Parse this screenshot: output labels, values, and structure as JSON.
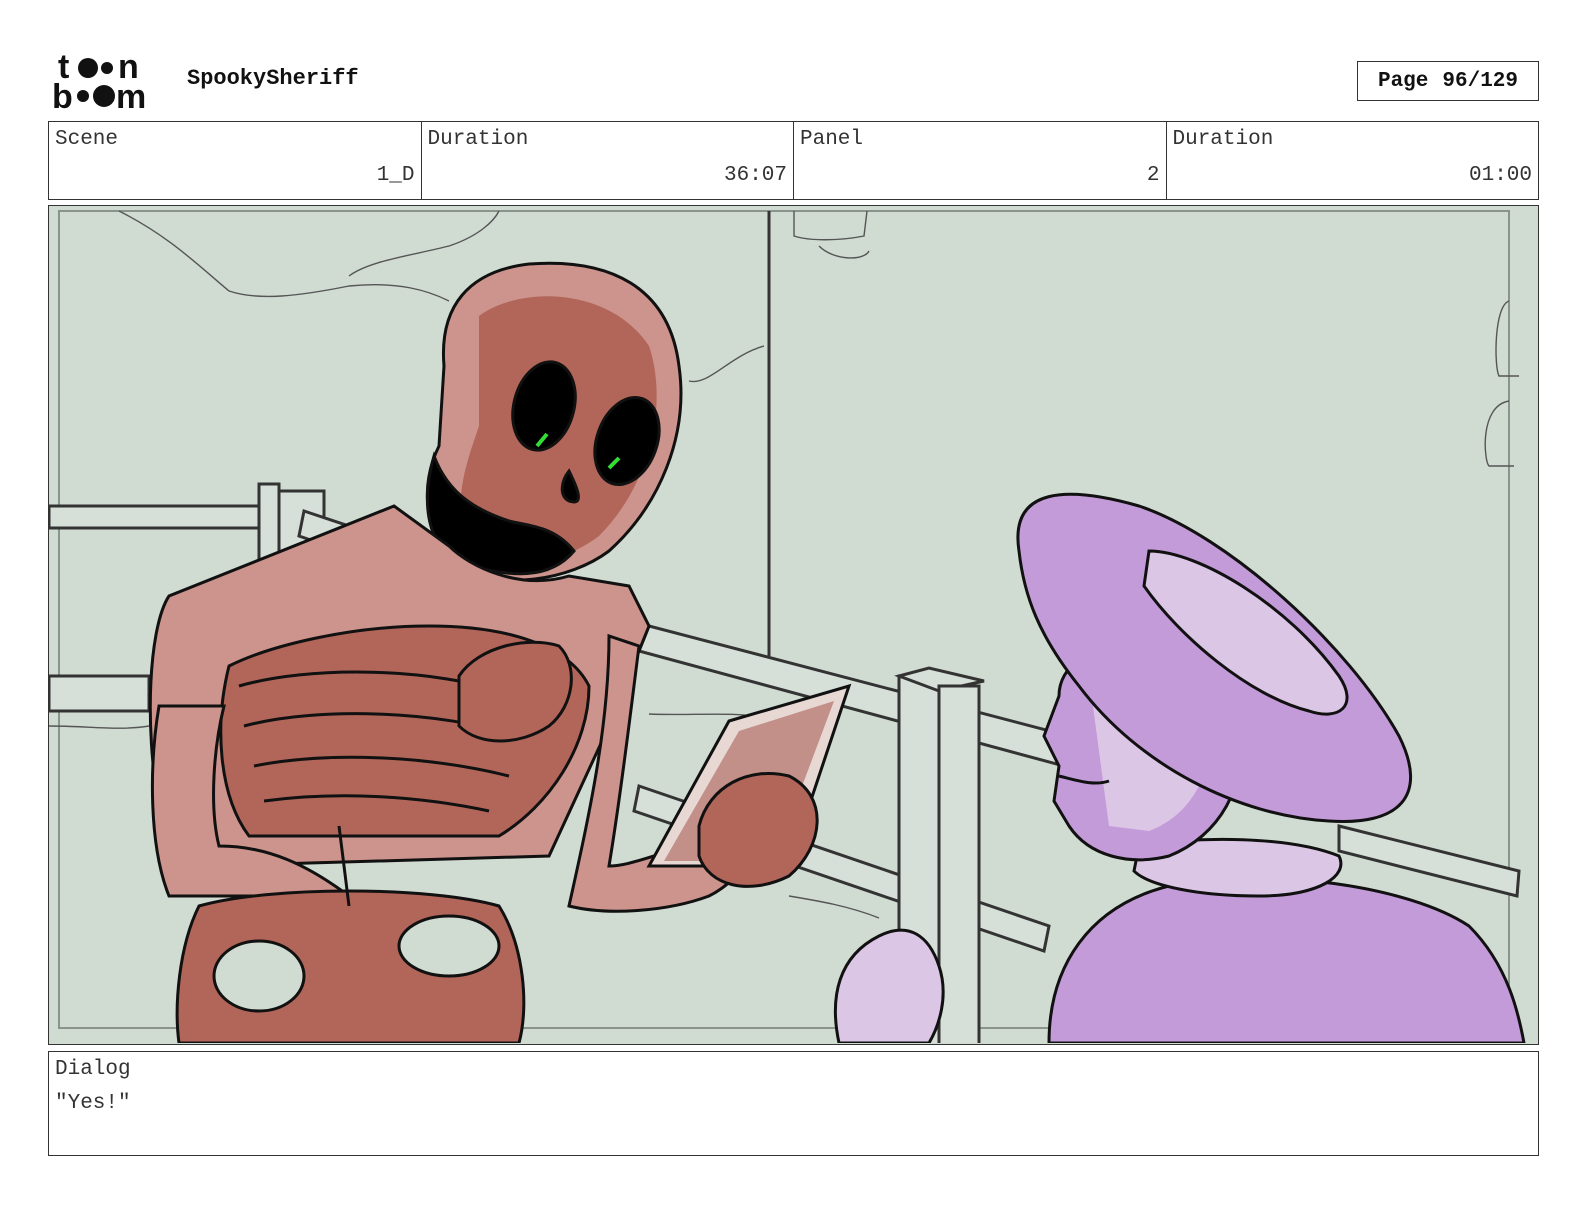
{
  "header": {
    "logo_text": "toonboom",
    "project_title": "SpookySheriff",
    "page_label": "Page",
    "page_number": "96/129"
  },
  "info": [
    {
      "label": "Scene",
      "value": "1_D"
    },
    {
      "label": "Duration",
      "value": "36:07"
    },
    {
      "label": "Panel",
      "value": "2"
    },
    {
      "label": "Duration",
      "value": "01:00"
    }
  ],
  "panel": {
    "background_color": "#d0dbd2",
    "skeleton_color": "#b2665a",
    "skeleton_highlight": "#cc948c",
    "cowgirl_color": "#c49bd9",
    "cowgirl_highlight": "#dcc6e6",
    "eye_glow_color": "#33dd33"
  },
  "dialog": {
    "label": "Dialog",
    "text": "\"Yes!\""
  }
}
